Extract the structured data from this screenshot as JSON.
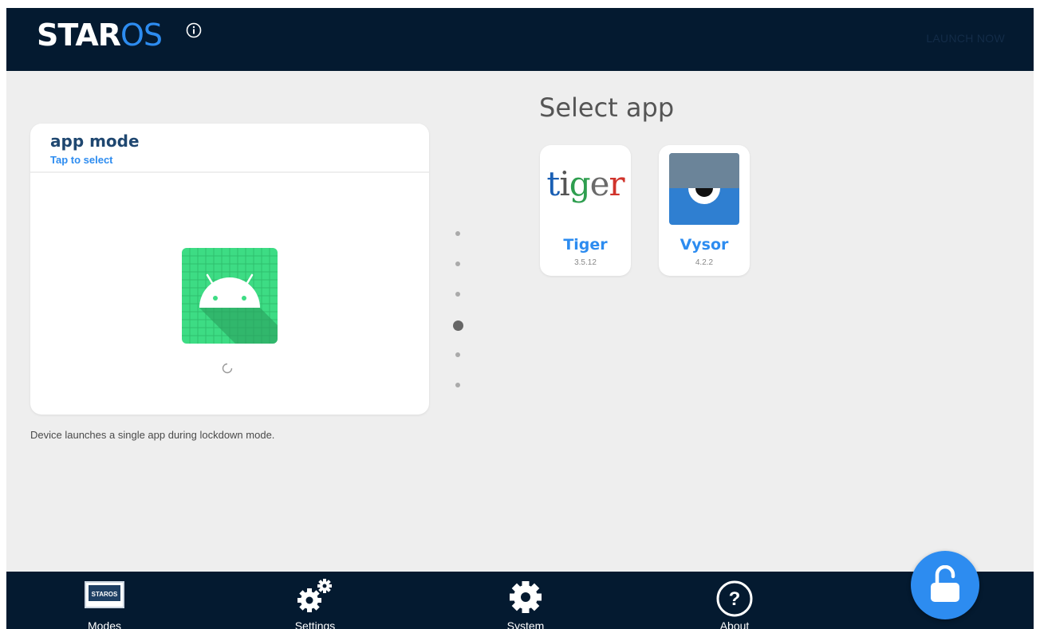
{
  "header": {
    "logo_star": "STAR",
    "logo_os": "OS",
    "launch_label": "LAUNCH NOW"
  },
  "mode_card": {
    "title": "app mode",
    "subtitle": "Tap to select",
    "description": "Device launches a single app during lockdown mode."
  },
  "pager": {
    "total_pages": 6,
    "active_index": 3
  },
  "select_app": {
    "title": "Select app",
    "apps": [
      {
        "name": "Tiger",
        "version": "3.5.12",
        "logo_text": "tiger",
        "icon": "tiger-logo-icon"
      },
      {
        "name": "Vysor",
        "version": "4.2.2",
        "icon": "vysor-eye-icon"
      }
    ]
  },
  "bottom_nav": {
    "items": [
      {
        "label": "Modes",
        "icon": "staros-screen-icon"
      },
      {
        "label": "Settings",
        "icon": "gears-icon"
      },
      {
        "label": "System",
        "icon": "gear-icon"
      },
      {
        "label": "About",
        "icon": "question-circle-icon"
      }
    ]
  },
  "fab": {
    "icon": "unlock-icon"
  },
  "colors": {
    "navy": "#041a30",
    "accent_blue": "#2d8cf0",
    "background": "#eeeeee",
    "android_green": "#3ddc84"
  }
}
